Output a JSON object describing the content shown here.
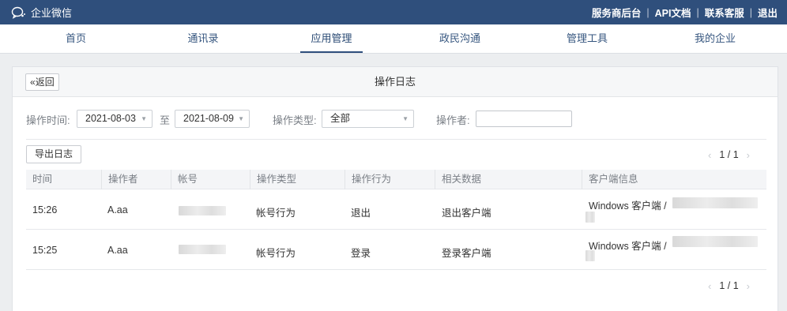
{
  "app": {
    "name": "企业微信"
  },
  "top_links": [
    "服务商后台",
    "API文档",
    "联系客服",
    "退出"
  ],
  "nav": {
    "items": [
      "首页",
      "通讯录",
      "应用管理",
      "政民沟通",
      "管理工具",
      "我的企业"
    ],
    "active": "应用管理"
  },
  "panel": {
    "back_label": "返回",
    "title": "操作日志"
  },
  "filters": {
    "time_label": "操作时间:",
    "date_from": "2021-08-03",
    "to_label": "至",
    "date_to": "2021-08-09",
    "type_label": "操作类型:",
    "type_value": "全部",
    "operator_label": "操作者:",
    "operator_value": ""
  },
  "export_label": "导出日志",
  "pagination": {
    "top": "1 / 1",
    "bottom": "1 / 1"
  },
  "table": {
    "columns": [
      "时间",
      "操作者",
      "帐号",
      "操作类型",
      "操作行为",
      "相关数据",
      "客户端信息"
    ],
    "rows": [
      {
        "time": "15:26",
        "operator": "A.aa",
        "type": "帐号行为",
        "action": "退出",
        "related": "退出客户端",
        "client": "Windows 客户端 /"
      },
      {
        "time": "15:25",
        "operator": "A.aa",
        "type": "帐号行为",
        "action": "登录",
        "related": "登录客户端",
        "client": "Windows 客户端 /"
      }
    ]
  },
  "colors": {
    "topbar": "#2f4f7c",
    "nav_text": "#36567f",
    "background": "#eceef0"
  }
}
